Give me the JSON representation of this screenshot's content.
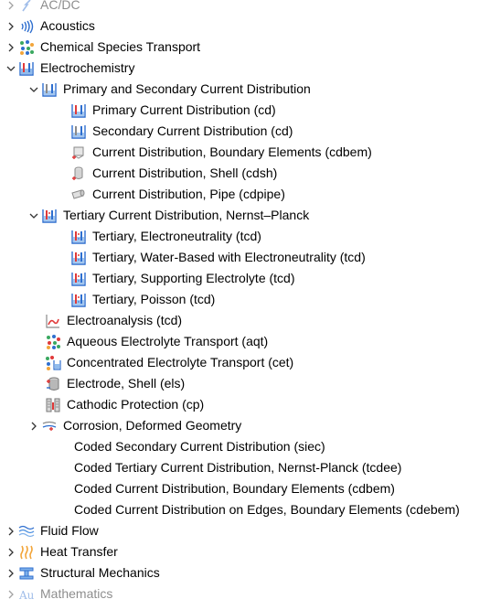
{
  "tree": {
    "items": [
      {
        "label": "AC/DC",
        "faded": true
      },
      {
        "label": "Acoustics"
      },
      {
        "label": "Chemical Species Transport"
      },
      {
        "label": "Electrochemistry"
      },
      {
        "label": "Primary and Secondary Current Distribution"
      },
      {
        "label": "Primary Current Distribution (cd)"
      },
      {
        "label": "Secondary Current Distribution (cd)"
      },
      {
        "label": "Current Distribution, Boundary Elements (cdbem)"
      },
      {
        "label": "Current Distribution, Shell (cdsh)"
      },
      {
        "label": "Current Distribution, Pipe (cdpipe)"
      },
      {
        "label": "Tertiary Current Distribution, Nernst–Planck"
      },
      {
        "label": "Tertiary, Electroneutrality (tcd)"
      },
      {
        "label": "Tertiary, Water-Based with Electroneutrality (tcd)"
      },
      {
        "label": "Tertiary, Supporting Electrolyte (tcd)"
      },
      {
        "label": "Tertiary, Poisson (tcd)"
      },
      {
        "label": "Electroanalysis (tcd)"
      },
      {
        "label": "Aqueous Electrolyte Transport (aqt)"
      },
      {
        "label": "Concentrated Electrolyte Transport (cet)"
      },
      {
        "label": "Electrode, Shell (els)"
      },
      {
        "label": "Cathodic Protection (cp)"
      },
      {
        "label": "Corrosion, Deformed Geometry"
      },
      {
        "label": "Coded Secondary Current Distribution (siec)"
      },
      {
        "label": "Coded Tertiary Current Distribution, Nernst-Planck (tcdee)"
      },
      {
        "label": "Coded Current Distribution, Boundary Elements (cdbem)"
      },
      {
        "label": "Coded Current Distribution on Edges, Boundary Elements (cdebem)"
      },
      {
        "label": "Fluid Flow"
      },
      {
        "label": "Heat Transfer"
      },
      {
        "label": "Structural Mechanics"
      },
      {
        "label": "Mathematics",
        "faded": true
      }
    ]
  },
  "colors": {
    "accent_blue": "#2f6fcf",
    "beaker_blue": "#4a8fe0",
    "red": "#e03a3a",
    "orange": "#f2a53a",
    "green": "#3aa860",
    "gray": "#8a8a8a"
  }
}
